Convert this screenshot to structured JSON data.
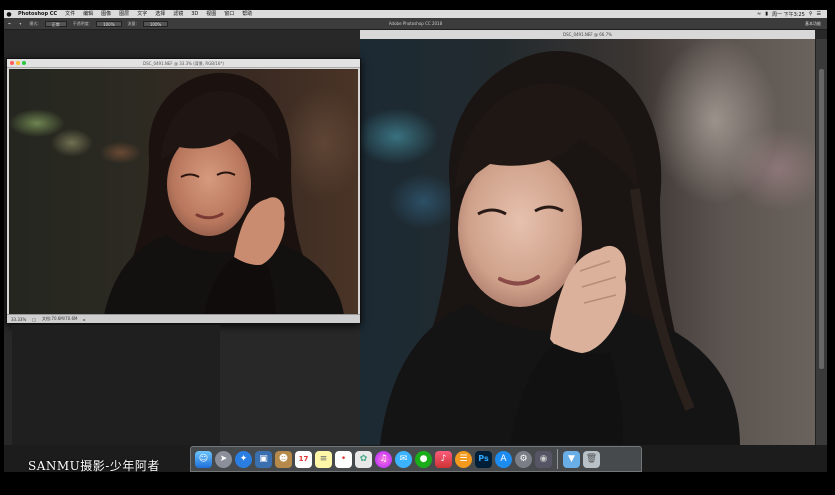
{
  "menubar": {
    "app_name": "Photoshop CC",
    "items": [
      "文件",
      "编辑",
      "图像",
      "图层",
      "文字",
      "选择",
      "滤镜",
      "3D",
      "视图",
      "窗口",
      "帮助"
    ],
    "status_text": "周一 下午3:25"
  },
  "options_bar": {
    "mode_label": "模式:",
    "mode_value": "正常",
    "opacity_label": "不透明度:",
    "opacity_value": "100%",
    "flow_label": "流量:",
    "flow_value": "100%",
    "window_title": "Adobe Photoshop CC 2018",
    "workspace": "基本功能"
  },
  "left_doc": {
    "title": "DSC_0491.NEF @ 33.3% (背景, RGB/16*)",
    "zoom": "33.33%",
    "doc_info": "文档:70.6M/70.6M"
  },
  "right_doc": {
    "title": "DSC_0491.NEF @ 66.7%"
  },
  "watermark": "SANMU摄影-少年阿者",
  "dock": {
    "icons": [
      "finder-icon",
      "launchpad-icon",
      "safari-icon",
      "preview-icon",
      "contacts-icon",
      "calendar-icon",
      "notes-icon",
      "reminders-icon",
      "photos-icon",
      "itunes-icon",
      "messages-icon",
      "wechat-icon",
      "music-icon",
      "ibooks-icon",
      "photoshop-icon",
      "app-store-icon",
      "system-preferences-icon",
      "image-capture-icon",
      "downloads-folder-icon",
      "trash-icon"
    ],
    "calendar_day": "17",
    "ps_label": "Ps"
  },
  "colors": {
    "menubar_bg": "#dcdcdc",
    "ps_blue": "#31a8ff",
    "ps_dark": "#001e36"
  }
}
